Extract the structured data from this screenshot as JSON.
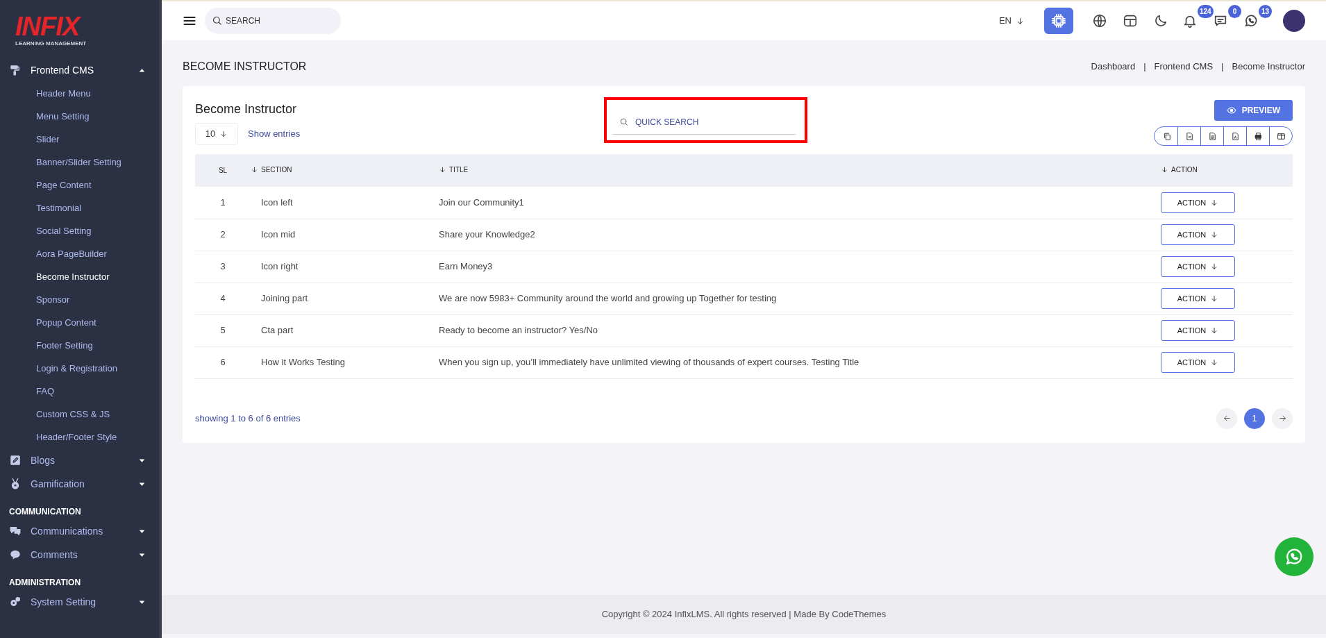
{
  "sidebar": {
    "logo": {
      "name": "INFIX",
      "tagline": "LEARNING MANAGEMENT"
    },
    "items": [
      {
        "kind": "group",
        "label": "Frontend CMS",
        "expanded": true,
        "children": [
          {
            "label": "Header Menu",
            "selected": false
          },
          {
            "label": "Menu Setting",
            "selected": false
          },
          {
            "label": "Slider",
            "selected": false
          },
          {
            "label": "Banner/Slider Setting",
            "selected": false
          },
          {
            "label": "Page Content",
            "selected": false
          },
          {
            "label": "Testimonial",
            "selected": false
          },
          {
            "label": "Social Setting",
            "selected": false
          },
          {
            "label": "Aora PageBuilder",
            "selected": false
          },
          {
            "label": "Become Instructor",
            "selected": true
          },
          {
            "label": "Sponsor",
            "selected": false
          },
          {
            "label": "Popup Content",
            "selected": false
          },
          {
            "label": "Footer Setting",
            "selected": false
          },
          {
            "label": "Login & Registration",
            "selected": false
          },
          {
            "label": "FAQ",
            "selected": false
          },
          {
            "label": "Custom CSS & JS",
            "selected": false
          },
          {
            "label": "Header/Footer Style",
            "selected": false
          }
        ]
      },
      {
        "kind": "group",
        "label": "Blogs",
        "expanded": false
      },
      {
        "kind": "group",
        "label": "Gamification",
        "expanded": false
      },
      {
        "kind": "heading",
        "label": "COMMUNICATION"
      },
      {
        "kind": "group",
        "label": "Communications",
        "expanded": false
      },
      {
        "kind": "group",
        "label": "Comments",
        "expanded": false
      },
      {
        "kind": "heading",
        "label": "ADMINISTRATION"
      },
      {
        "kind": "group",
        "label": "System Setting",
        "expanded": false
      }
    ]
  },
  "topbar": {
    "search": {
      "placeholder": "SEARCH"
    },
    "language": "EN",
    "badges": [
      "124",
      "0",
      "13"
    ]
  },
  "page": {
    "title": "BECOME INSTRUCTOR",
    "breadcrumb": [
      "Dashboard",
      "Frontend CMS",
      "Become Instructor"
    ],
    "separators": [
      "|",
      "|"
    ]
  },
  "card": {
    "title": "Become Instructor",
    "preview_button": "PREVIEW",
    "page_size": "10",
    "show_entries": "Show entries",
    "quick_search": {
      "placeholder": "QUICK SEARCH",
      "highlighted": true
    },
    "columns": [
      {
        "label": "SL",
        "sortable": false
      },
      {
        "label": "SECTION",
        "sortable": true
      },
      {
        "label": "TITLE",
        "sortable": true
      },
      {
        "label": "ACTION",
        "sortable": true
      }
    ],
    "rows": [
      {
        "sl": "1",
        "section": "Icon left",
        "title": "Join our Community1",
        "action": "ACTION"
      },
      {
        "sl": "2",
        "section": "Icon mid",
        "title": "Share your Knowledge2",
        "action": "ACTION"
      },
      {
        "sl": "3",
        "section": "Icon right",
        "title": "Earn Money3",
        "action": "ACTION"
      },
      {
        "sl": "4",
        "section": "Joining part",
        "title": "We are now 5983+ Community around the world and growing up Together for testing",
        "action": "ACTION"
      },
      {
        "sl": "5",
        "section": "Cta part",
        "title": "Ready to become an instructor? Yes/No",
        "action": "ACTION"
      },
      {
        "sl": "6",
        "section": "How it Works Testing",
        "title": "When you sign up, you’ll immediately have unlimited viewing of thousands of expert courses. Testing Title",
        "action": "ACTION"
      }
    ],
    "summary": "showing 1 to 6 of 6 entries",
    "pages": [
      {
        "label": "1",
        "selected": true
      }
    ]
  },
  "footer": "Copyright © 2024 InfixLMS. All rights reserved | Made By CodeThemes"
}
